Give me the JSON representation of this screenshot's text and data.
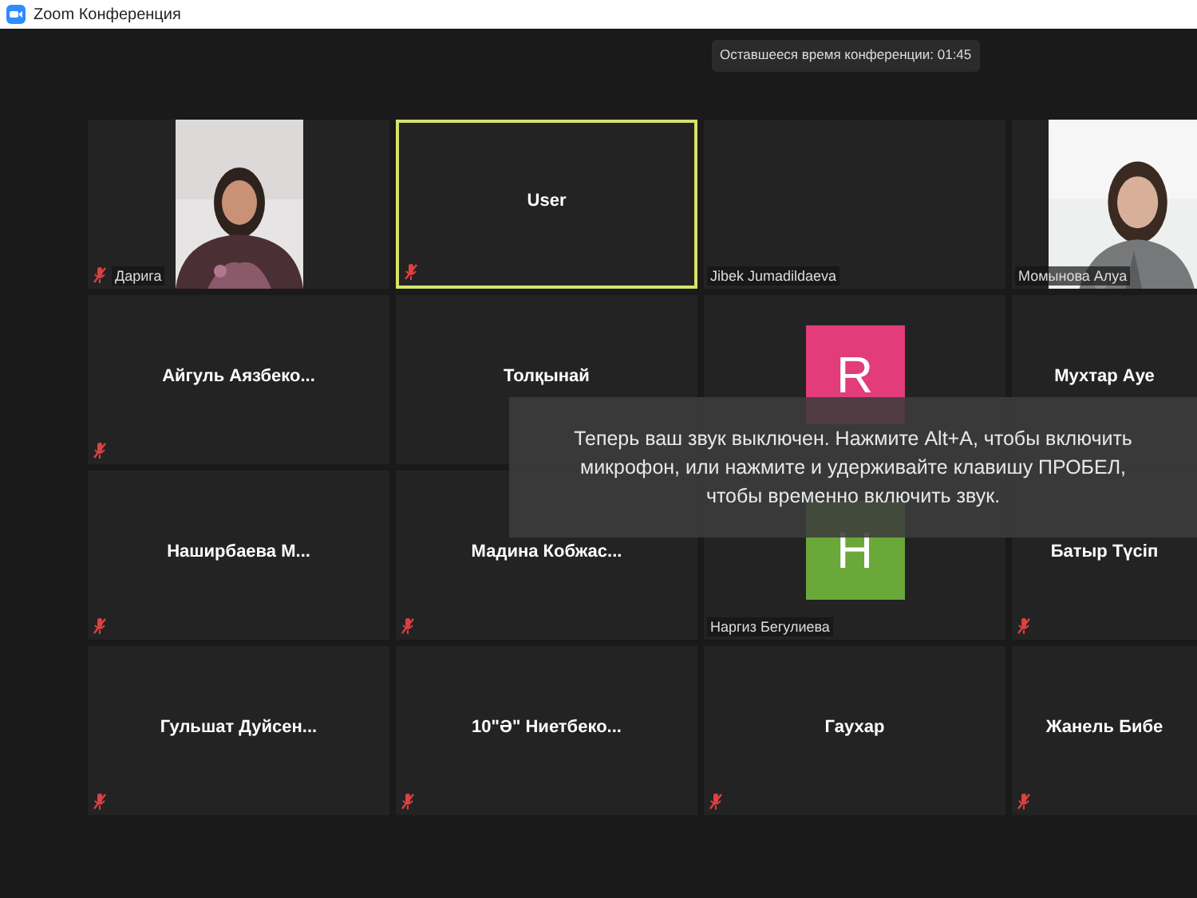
{
  "window": {
    "title": "Zoom Конференция"
  },
  "timer": "Оставшееся время конференции: 01:45",
  "tiles": [
    {
      "kind": "video",
      "name": "Дарига",
      "muted": true,
      "highlighted": false
    },
    {
      "kind": "name",
      "name": "User",
      "muted": true,
      "highlighted": true
    },
    {
      "kind": "label",
      "name": "Jibek Jumadildaeva",
      "muted": false,
      "highlighted": false
    },
    {
      "kind": "video",
      "name": "Момынова Алуа",
      "muted": false,
      "highlighted": false
    },
    {
      "kind": "name",
      "name": "Айгуль  Аязбеко...",
      "muted": true,
      "highlighted": false
    },
    {
      "kind": "name",
      "name": "Толқынай",
      "muted": false,
      "highlighted": false
    },
    {
      "kind": "avatar",
      "letter": "R",
      "color": "#e23c7a",
      "muted": false,
      "highlighted": false
    },
    {
      "kind": "name",
      "name": "Мухтар Ауе",
      "muted": false,
      "highlighted": false
    },
    {
      "kind": "name",
      "name": "Наширбаева  М...",
      "muted": true,
      "highlighted": false
    },
    {
      "kind": "name",
      "name": "Мадина  Кобжас...",
      "muted": true,
      "highlighted": false
    },
    {
      "kind": "avatar",
      "name": "Наргиз Бегулиева",
      "letter": "H",
      "color": "#6aa83a",
      "muted": false,
      "highlighted": false
    },
    {
      "kind": "name",
      "name": "Батыр Түсіп",
      "muted": true,
      "highlighted": false
    },
    {
      "kind": "name",
      "name": "Гульшат  Дуйсен...",
      "muted": true,
      "highlighted": false
    },
    {
      "kind": "name",
      "name": "10\"Ә\" Ниетбеко...",
      "muted": true,
      "highlighted": false
    },
    {
      "kind": "name",
      "name": "Гаухар",
      "muted": true,
      "highlighted": false
    },
    {
      "kind": "name",
      "name": "Жанель  Бибе",
      "muted": true,
      "highlighted": false
    }
  ],
  "toast": {
    "text": "Теперь ваш звук выключен. Нажмите Alt+A, чтобы включить микрофон, или нажмите и удерживайте клавишу ПРОБЕЛ, чтобы временно включить звук."
  }
}
